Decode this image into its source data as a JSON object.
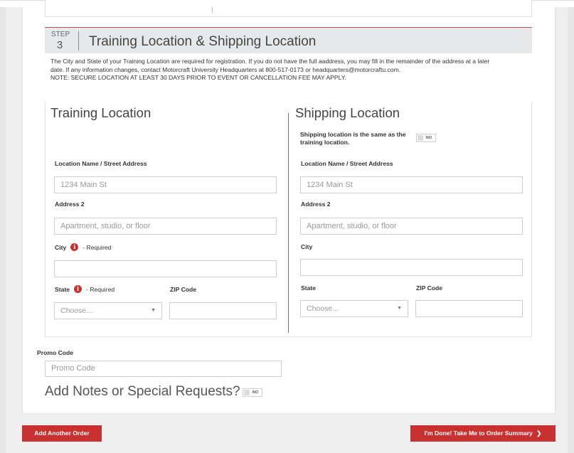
{
  "step": {
    "label": "STEP",
    "number": "3",
    "title": "Training Location & Shipping Location",
    "intro_line1": "The City and State of your Training Location are required for registration. If you do not have the full aaddress, you may fill in the remainder of the address at a later",
    "intro_line2": "date. If any information changes, contact Motorcraft University Headquarters at 800-517-0173 or headquarters@motorcraftu.com.",
    "intro_line3": "NOTE: SECURE LOCATION AT LEAST 30 DAYS PRIOR TO EVENT OR CANCELLATION FEE MAY APPLY."
  },
  "training": {
    "title": "Training Location",
    "street_label": "Location Name / Street Address",
    "street_placeholder": "1234 Main St",
    "address2_label": "Address 2",
    "address2_placeholder": "Apartment, studio, or floor",
    "city_label": "City",
    "city_required": "- Required",
    "state_label": "State",
    "state_required": "- Required",
    "state_selected": "Choose...",
    "zip_label": "ZIP Code"
  },
  "shipping": {
    "title": "Shipping Location",
    "same_label": "Shipping location is the same as the training location.",
    "same_toggle": "NO",
    "street_label": "Location Name / Street Address",
    "street_placeholder": "1234 Main St",
    "address2_label": "Address 2",
    "address2_placeholder": "Apartment, studio, or floor",
    "city_label": "City",
    "state_label": "State",
    "state_selected": "Choose...",
    "zip_label": "ZIP Code"
  },
  "promo": {
    "label": "Promo Code",
    "placeholder": "Promo Code"
  },
  "notes": {
    "title": "Add Notes or Special Requests?",
    "toggle": "NO"
  },
  "footer": {
    "add_order": "Add Another Order",
    "done": "I'm Done! Take Me to Order Summary",
    "done_icon": "chevron-right-icon"
  },
  "colors": {
    "accent": "#c8312f",
    "header_bg": "#e6e8ea"
  }
}
